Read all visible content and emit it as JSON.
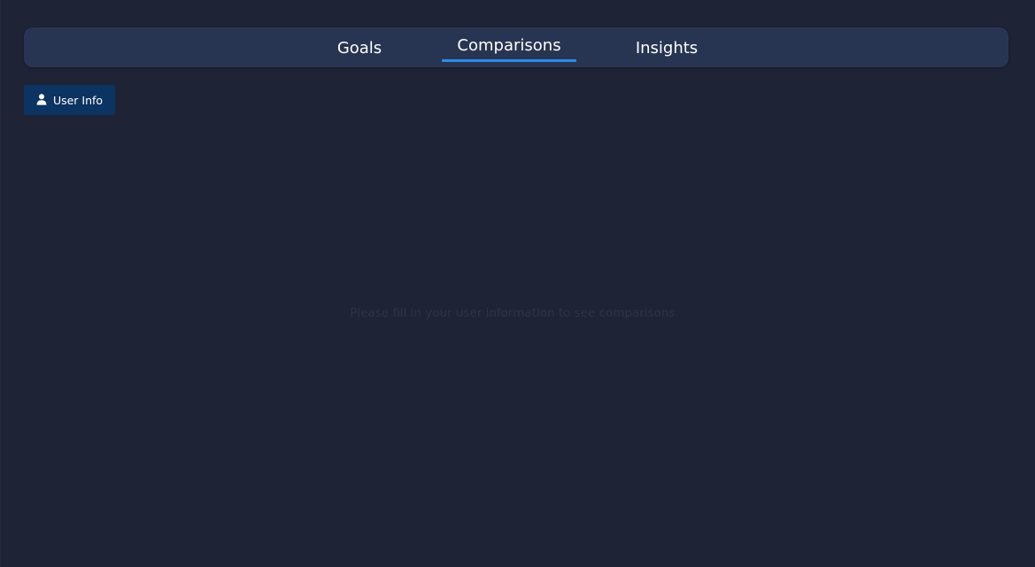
{
  "nav": {
    "tabs": [
      {
        "label": "Goals",
        "active": false
      },
      {
        "label": "Comparisons",
        "active": true
      },
      {
        "label": "Insights",
        "active": false
      }
    ],
    "active_indicator_color": "#2a8ee8"
  },
  "toolbar": {
    "user_info_label": "User Info",
    "user_info_icon": "user-icon"
  },
  "main": {
    "empty_message": "Please fill in your user information to see comparisons."
  },
  "colors": {
    "background": "#1e2336",
    "tabbar": "#283552",
    "button": "#0c3462"
  }
}
